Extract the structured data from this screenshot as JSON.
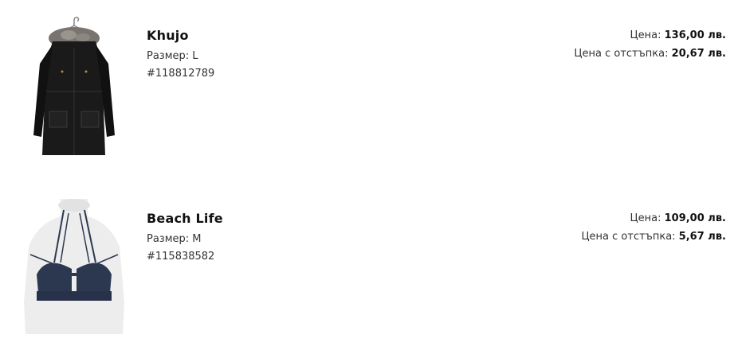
{
  "items": [
    {
      "brand": "Khujo",
      "size_label": "Размер:",
      "size_value": "L",
      "sku": "#118812789",
      "price_label": "Цена:",
      "price": "136,00 лв.",
      "discount_label": "Цена с отстъпка:",
      "discount_price": "20,67 лв.",
      "image_icon": "black-parka-with-fur-hood",
      "image_color": "#1a1a1a"
    },
    {
      "brand": "Beach Life",
      "size_label": "Размер:",
      "size_value": "M",
      "sku": "#115838582",
      "price_label": "Цена:",
      "price": "109,00 лв.",
      "discount_label": "Цена с отстъпка:",
      "discount_price": "5,67 лв.",
      "image_icon": "navy-bikini-top-on-mannequin",
      "image_color": "#2c3850"
    }
  ]
}
